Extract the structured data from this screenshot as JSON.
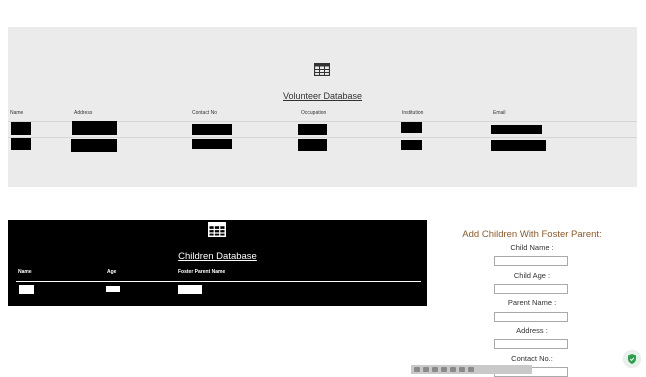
{
  "volunteer": {
    "title": "Volunteer Database",
    "columns": [
      "Name",
      "Address",
      "Contact No",
      "Occupation",
      "Institution",
      "Email"
    ]
  },
  "children": {
    "title": "Children Database",
    "columns": [
      "Name",
      "Age",
      "Foster Parent Name"
    ]
  },
  "form": {
    "title": "Add Children With Foster Parent:",
    "labels": [
      "Child Name :",
      "Child Age :",
      "Parent Name :",
      "Address :",
      "Contact No.:"
    ]
  },
  "icons": {
    "volunteer": "table-grid-icon",
    "children": "table-grid-icon",
    "corner": "shield-icon"
  },
  "colors": {
    "form_title": "#8b5a2b",
    "panel_bg": "#ebebeb",
    "child_bg": "#000000"
  }
}
